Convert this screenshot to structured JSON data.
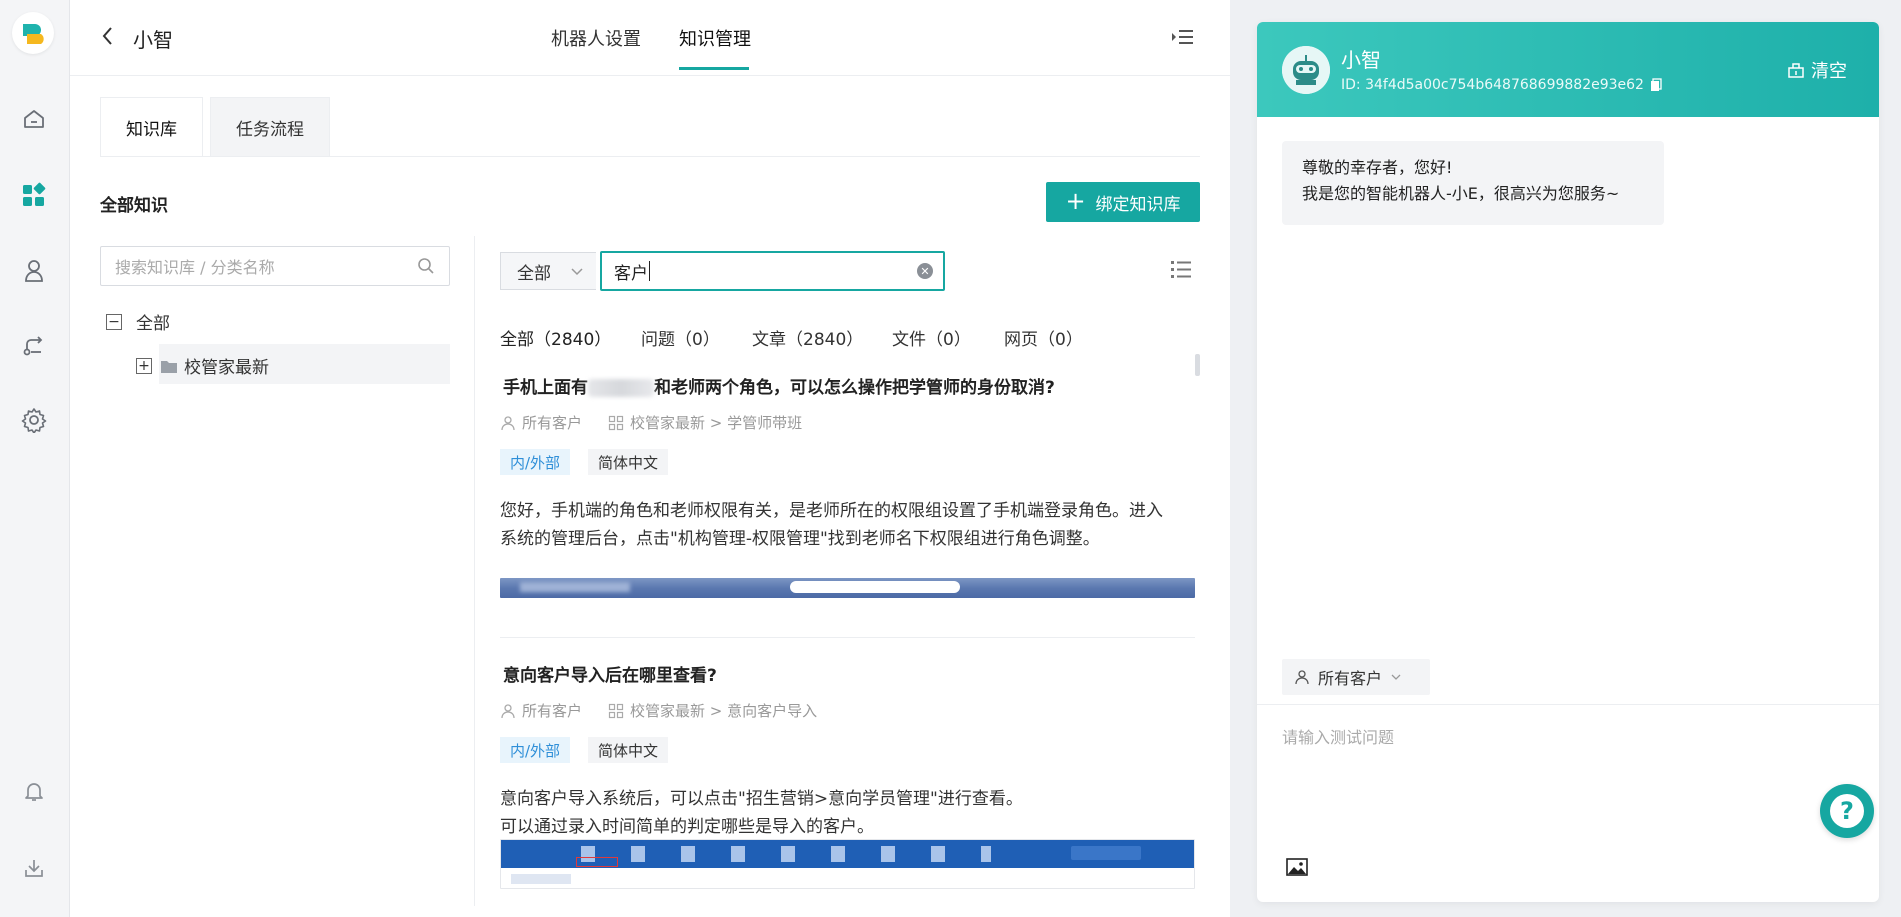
{
  "topbar": {
    "bot_name": "小智",
    "tabs": [
      {
        "label": "机器人设置"
      },
      {
        "label": "知识管理"
      }
    ]
  },
  "subtabs": [
    {
      "label": "知识库"
    },
    {
      "label": "任务流程"
    }
  ],
  "section": {
    "title": "全部知识",
    "bind_button": "绑定知识库"
  },
  "tree": {
    "search_placeholder": "搜索知识库 / 分类名称",
    "nodes": [
      {
        "label": "全部",
        "toggle": "−"
      },
      {
        "label": "校管家最新",
        "toggle": "+"
      }
    ]
  },
  "search": {
    "filter_value": "全部",
    "query": "客户"
  },
  "categories": [
    {
      "label": "全部（2840）"
    },
    {
      "label": "问题（0）"
    },
    {
      "label": "文章（2840）"
    },
    {
      "label": "文件（0）"
    },
    {
      "label": "网页（0）"
    }
  ],
  "items": [
    {
      "title_before": "手机上面有",
      "title_after": "和老师两个角色，可以怎么操作把学管师的身份取消?",
      "audience": "所有客户",
      "path": "校管家最新 > 学管师带班",
      "tag1": "内/外部",
      "tag2": "简体中文",
      "body_line1": "您好，手机端的角色和老师权限有关，是老师所在的权限组设置了手机端登录角色。进入",
      "body_line2": "系统的管理后台，点击\"机构管理-权限管理\"找到老师名下权限组进行角色调整。"
    },
    {
      "title": "意向客户导入后在哪里查看?",
      "audience": "所有客户",
      "path": "校管家最新 > 意向客户导入",
      "tag1": "内/外部",
      "tag2": "简体中文",
      "body_line1": "意向客户导入系统后，可以点击\"招生营销>意向学员管理\"进行查看。",
      "body_line2": "可以通过录入时间简单的判定哪些是导入的客户。"
    }
  ],
  "chat": {
    "name": "小智",
    "id_text": "ID: 34f4d5a00c754b648768699882e93e62",
    "clear_label": "清空",
    "greeting_line1": "尊敬的幸存者，您好!",
    "greeting_line2": "我是您的智能机器人-小E，很高兴为您服务~",
    "audience": "所有客户",
    "input_placeholder": "请输入测试问题"
  },
  "colors": {
    "accent": "#16a7a1",
    "header_gradient_start": "#3cc8bd",
    "header_gradient_end": "#1eb0aa",
    "tag_blue": "#2f8fd8"
  }
}
